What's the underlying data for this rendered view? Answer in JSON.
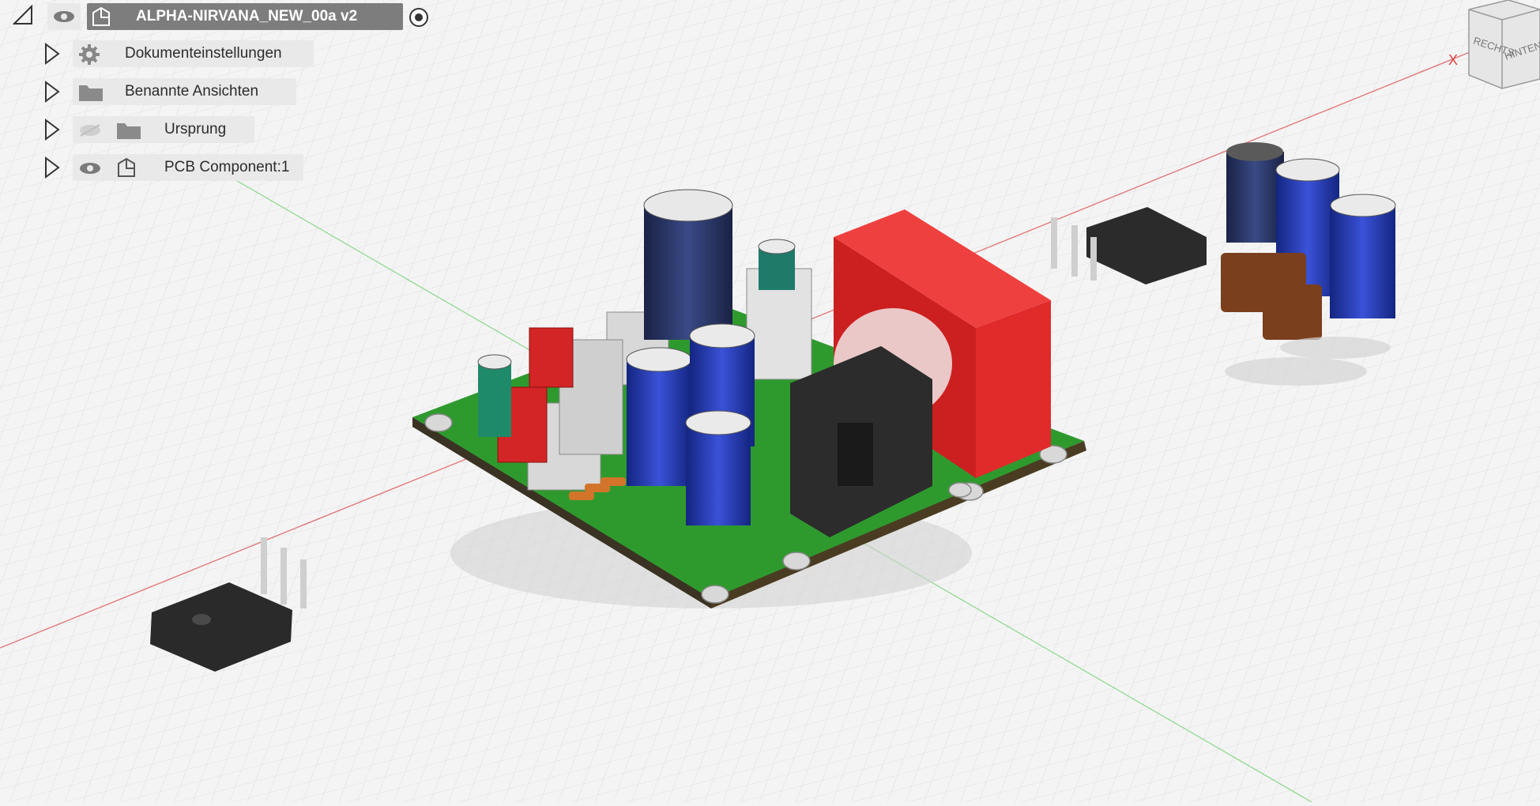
{
  "browser": {
    "root": {
      "label": "ALPHA-NIRVANA_NEW_00a v2"
    },
    "items": [
      {
        "label": "Dokumenteinstellungen",
        "icon": "gear-icon"
      },
      {
        "label": "Benannte Ansichten",
        "icon": "folder-icon"
      },
      {
        "label": "Ursprung",
        "icon": "folder-icon",
        "visibility": "hidden"
      },
      {
        "label": "PCB Component:1",
        "icon": "component-icon",
        "visibility": "visible"
      }
    ]
  },
  "viewcube": {
    "right_label": "RECHTS",
    "back_label": "HINTEN"
  },
  "axis": {
    "x_label": "X"
  },
  "colors": {
    "pcb": "#2e9a2e",
    "transformer": "#e12a2a",
    "cap_blue": "#1f34a8",
    "cap_navy": "#1f2a55",
    "heatsink": "#2e2e2e",
    "film_cap": "#7a3f1d"
  }
}
